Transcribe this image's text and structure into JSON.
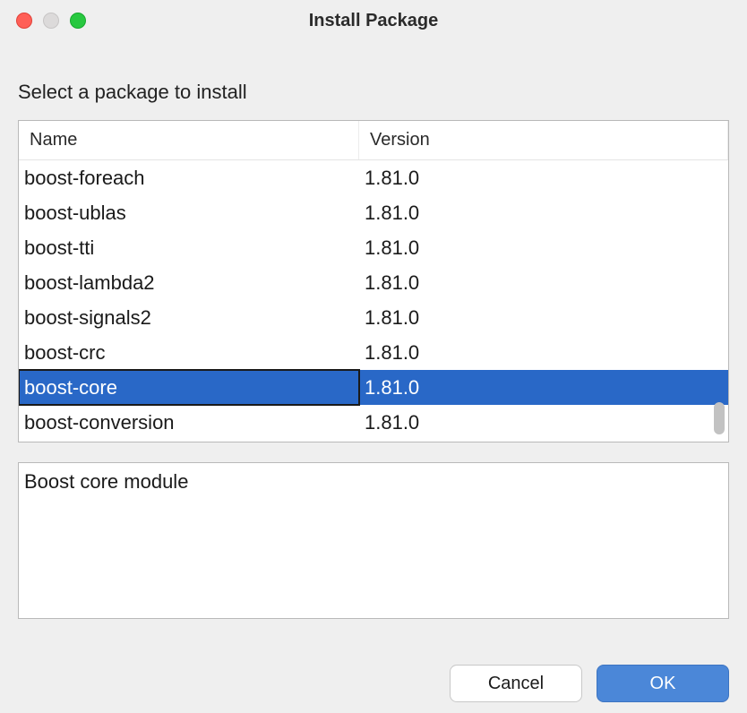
{
  "window": {
    "title": "Install Package"
  },
  "instruction": "Select a package to install",
  "table": {
    "headers": {
      "name": "Name",
      "version": "Version"
    },
    "rows": [
      {
        "name": "boost-foreach",
        "version": "1.81.0",
        "selected": false
      },
      {
        "name": "boost-ublas",
        "version": "1.81.0",
        "selected": false
      },
      {
        "name": "boost-tti",
        "version": "1.81.0",
        "selected": false
      },
      {
        "name": "boost-lambda2",
        "version": "1.81.0",
        "selected": false
      },
      {
        "name": "boost-signals2",
        "version": "1.81.0",
        "selected": false
      },
      {
        "name": "boost-crc",
        "version": "1.81.0",
        "selected": false
      },
      {
        "name": "boost-core",
        "version": "1.81.0",
        "selected": true
      },
      {
        "name": "boost-conversion",
        "version": "1.81.0",
        "selected": false
      }
    ]
  },
  "description": "Boost core module",
  "buttons": {
    "cancel": "Cancel",
    "ok": "OK"
  }
}
